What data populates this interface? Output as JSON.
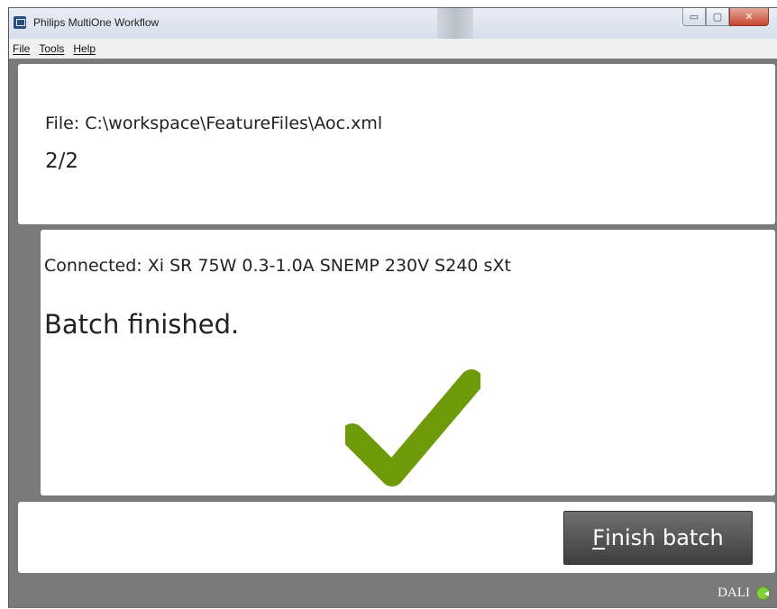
{
  "window": {
    "title": "Philips MultiOne Workflow",
    "minimize_glyph": "▭",
    "maximize_glyph": "▢",
    "close_glyph": "✕"
  },
  "menu": {
    "file": {
      "mnemonic": "F",
      "rest": "ile"
    },
    "tools": {
      "mnemonic": "T",
      "rest": "ools"
    },
    "help": {
      "mnemonic": "H",
      "rest": "elp"
    }
  },
  "top_panel": {
    "file_text": "File: C:\\workspace\\FeatureFiles\\Aoc.xml",
    "counter": "2/2"
  },
  "status_panel": {
    "connected_text": "Connected: Xi SR 75W 0.3-1.0A SNEMP 230V S240 sXt",
    "message": "Batch finished.",
    "check_icon": "checkmark-icon",
    "check_color": "#6e9a0a"
  },
  "actions": {
    "finish_mnemonic": "F",
    "finish_rest": "inish batch"
  },
  "statusbar": {
    "protocol": "DALI",
    "protocol_icon": "arrow-circle-icon",
    "protocol_icon_color": "#7fd13a"
  }
}
